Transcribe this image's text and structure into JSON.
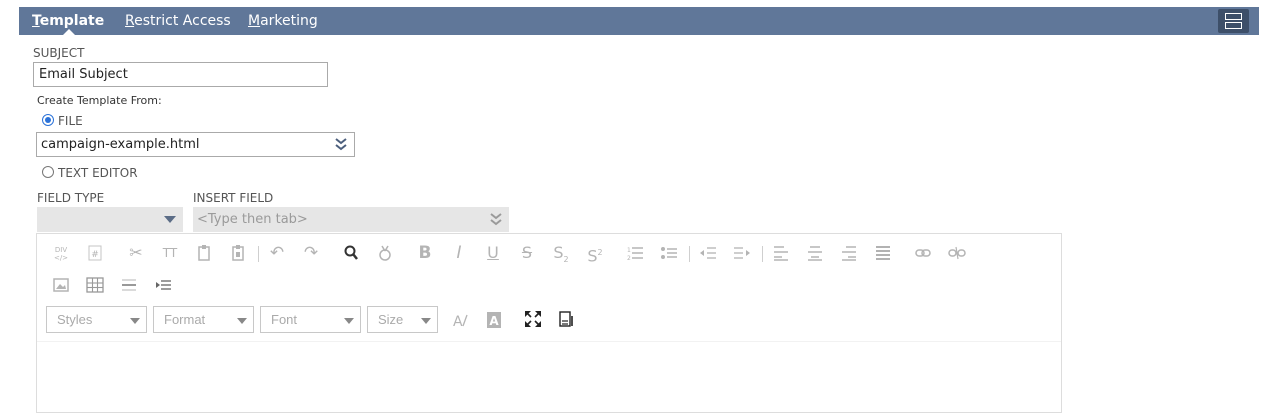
{
  "tabs": {
    "template": {
      "u": "T",
      "rest": "emplate"
    },
    "restrict": {
      "u": "R",
      "rest": "estrict Access"
    },
    "marketing": {
      "u": "M",
      "rest": "arketing"
    }
  },
  "form": {
    "subject_label": "SUBJECT",
    "subject_value": "Email Subject",
    "create_from_label": "Create Template From:",
    "file_option": "FILE",
    "file_value": "campaign-example.html",
    "text_editor_option": "TEXT EDITOR",
    "field_type_label": "FIELD TYPE",
    "field_type_value": "",
    "insert_field_label": "INSERT FIELD",
    "insert_field_placeholder": "<Type then tab>"
  },
  "editor": {
    "combos": {
      "styles": "Styles",
      "format": "Format",
      "font": "Font",
      "size": "Size"
    },
    "glyphs": {
      "bold": "B",
      "italic": "I",
      "underline": "U",
      "strike": "S",
      "subscript": "S",
      "superscript": "S",
      "text_size": "TT"
    }
  },
  "colors": {
    "tabbar": "#607799",
    "menu_button": "#3d4f69",
    "radio_selected": "#2b72d8",
    "field_disabled": "#e6e6e6"
  }
}
